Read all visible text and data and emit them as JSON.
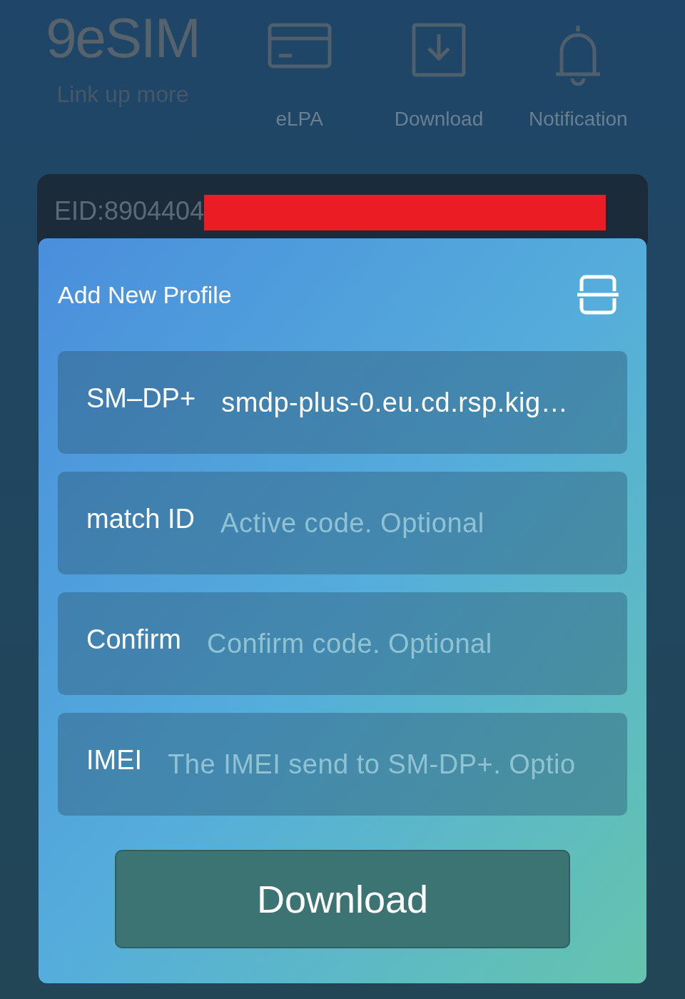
{
  "header": {
    "logo": "9eSIM",
    "tagline": "Link up more",
    "nav": [
      {
        "kind": "card",
        "label": "eLPA"
      },
      {
        "kind": "download",
        "label": "Download"
      },
      {
        "kind": "bell",
        "label": "Notification"
      }
    ]
  },
  "eid": {
    "text": "EID:8904404",
    "redacted": true
  },
  "dialog": {
    "title": "Add New Profile",
    "fields": [
      {
        "label": "SM–DP+",
        "value": "smdp-plus-0.eu.cd.rsp.kig…"
      },
      {
        "label": "match ID",
        "placeholder": "Active code. Optional"
      },
      {
        "label": "Confirm",
        "placeholder": "Confirm code. Optional"
      },
      {
        "label": "IMEI",
        "placeholder": "The IMEI send to SM-DP+. Optio"
      }
    ],
    "button": "Download"
  }
}
